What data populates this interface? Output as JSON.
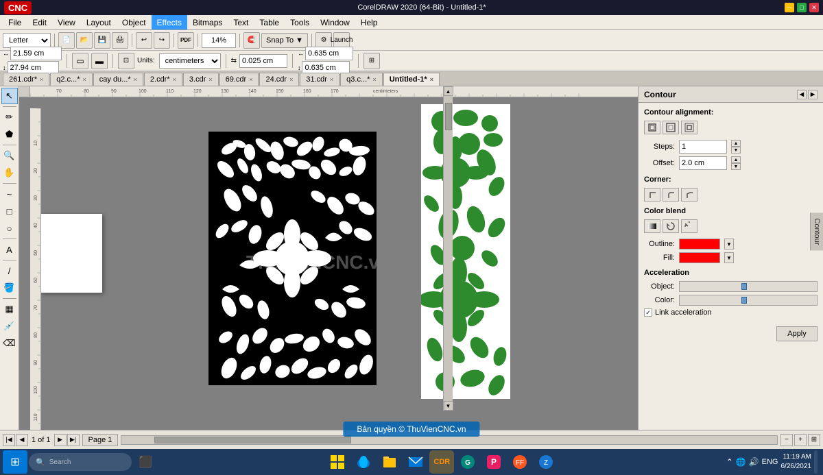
{
  "titlebar": {
    "title": "CorelDRAW 2020 (64-Bit) - Untitled-1*",
    "logo": "CNC"
  },
  "menu": {
    "items": [
      "File",
      "Edit",
      "View",
      "Layout",
      "Object",
      "Effects",
      "Bitmaps",
      "Text",
      "Table",
      "Tools",
      "Window",
      "Help"
    ]
  },
  "toolbar1": {
    "zoom_level": "14%",
    "snap_label": "Snap To",
    "launch_label": "Launch",
    "page_size": "Letter"
  },
  "toolbar2": {
    "width": "21.59 cm",
    "height": "27.94 cm",
    "units": "centimeters",
    "step1": "0.025 cm",
    "step2": "0.635 cm",
    "step3": "0.635 cm"
  },
  "tabs": [
    {
      "label": "261.cdr*",
      "active": false
    },
    {
      "label": "q2.c...*",
      "active": false
    },
    {
      "label": "cay du...*",
      "active": false
    },
    {
      "label": "2.cdr*",
      "active": false
    },
    {
      "label": "3.cdr",
      "active": false
    },
    {
      "label": "69.cdr",
      "active": false
    },
    {
      "label": "24.cdr",
      "active": false
    },
    {
      "label": "31.cdr",
      "active": false
    },
    {
      "label": "q3.c...*",
      "active": false
    },
    {
      "label": "Untitled-1*",
      "active": true
    }
  ],
  "right_panel": {
    "title": "Contour",
    "sections": {
      "contour_alignment": {
        "label": "Contour alignment:",
        "buttons": [
          "inside",
          "center",
          "outside"
        ]
      },
      "steps": {
        "label": "Steps:",
        "value": "1"
      },
      "offset": {
        "label": "Offset:",
        "value": "2.0 cm"
      },
      "corner": {
        "label": "Corner:",
        "buttons": [
          "miter",
          "round",
          "bevel"
        ]
      },
      "color_blend": {
        "label": "Color blend",
        "buttons": [
          "linear",
          "clockwise",
          "counter"
        ]
      },
      "outline": {
        "label": "Outline:",
        "color": "#ff0000"
      },
      "fill": {
        "label": "Fill:",
        "color": "#ff0000"
      },
      "acceleration": {
        "label": "Acceleration",
        "object_label": "Object:",
        "color_label": "Color:",
        "link_label": "Link acceleration",
        "checked": true
      },
      "apply": {
        "label": "Apply"
      }
    }
  },
  "bottom_bar": {
    "page_info": "1 of 1",
    "page_tab": "Page 1"
  },
  "taskbar": {
    "copyright": "Bản quyền © ThuVienCNC.vn",
    "time": "11:19 AM",
    "date": "6/26/2021",
    "lang": "ENG",
    "apps": [
      "⊞",
      "🔍",
      "📁",
      "🌐",
      "✉",
      "📷",
      "🎵",
      "🗂"
    ]
  }
}
